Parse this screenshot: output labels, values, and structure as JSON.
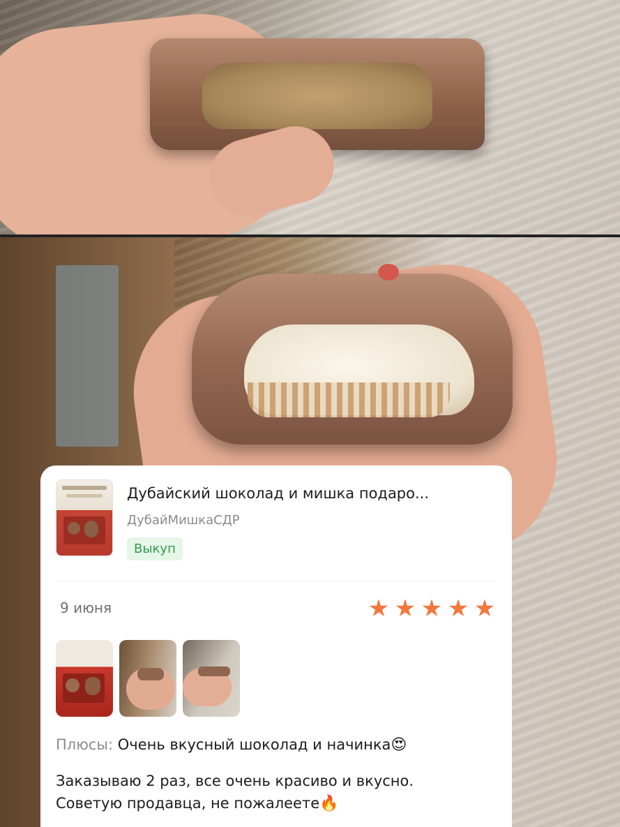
{
  "review": {
    "product": {
      "title": "Дубайский шоколад и мишка подаро...",
      "seller": "ДубайМишкаСДР",
      "badge": "Выкуп"
    },
    "date": "9 июня",
    "rating": 5,
    "stars": [
      "★",
      "★",
      "★",
      "★",
      "★"
    ],
    "pros_label": "Плюсы:",
    "pros_text": " Очень вкусный шоколад и начинка",
    "pros_emoji": "😍",
    "comment_line1": "Заказываю 2 раз, все очень красиво и вкусно.",
    "comment_line2": "Советую продавца, не пожалеете",
    "comment_emoji": "🔥",
    "colors": {
      "star": "#f2783d",
      "badge_bg": "#e6f6e9",
      "badge_text": "#2f9e4a"
    }
  }
}
